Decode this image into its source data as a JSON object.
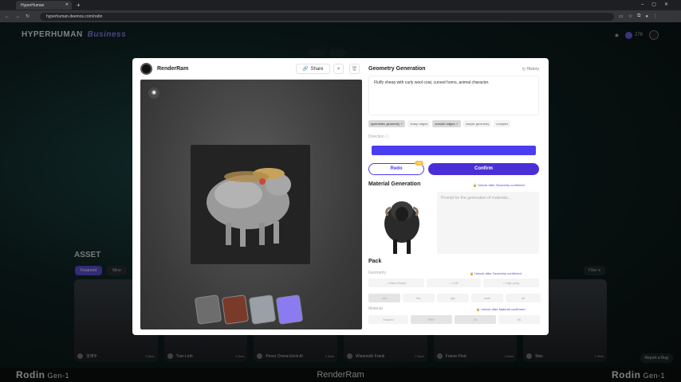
{
  "browser": {
    "tab_title": "HyperHuman",
    "url": "hyperhuman.deemos.com/rodin"
  },
  "header": {
    "brand": "HYPERHUMAN",
    "brand_suffix": "Business",
    "credits": "276"
  },
  "background": {
    "section_title": "ASSET",
    "filters": [
      "Featured",
      "Mine"
    ],
    "filter_button": "Filter",
    "cards": [
      {
        "author": "임재두",
        "likes": "2 likes"
      },
      {
        "author": "Tran Linh",
        "likes": "2 likes"
      },
      {
        "author": "Perez Orona Erick Al",
        "likes": "2 likes"
      },
      {
        "author": "Wiesmath Frank",
        "likes": "2 likes"
      },
      {
        "author": "Future Pied",
        "likes": "2 likes"
      },
      {
        "author": "Max",
        "likes": "2 likes"
      }
    ],
    "report_bug": "Report a Bug",
    "footer_left": "Rodin",
    "footer_left_suffix": "Gen-1",
    "footer_mid": "RenderRam",
    "footer_right": "Rodin",
    "footer_right_suffix": "Gen-1"
  },
  "modal": {
    "owner_name": "RenderRam",
    "share_label": "Share",
    "geometry": {
      "title": "Geometry Generation",
      "history_label": "History",
      "prompt": "Fluffy sheep with curly wool coat, curved horns, animal character.",
      "chips": [
        {
          "label": "symmetric geometry ✓",
          "selected": true
        },
        {
          "label": "sharp edges",
          "selected": false
        },
        {
          "label": "smooth edges ✓",
          "selected": true
        },
        {
          "label": "simple geometry",
          "selected": false
        },
        {
          "label": "complex",
          "selected": false
        }
      ],
      "direction_label": "Direction ⓘ",
      "redo_label": "Redo",
      "redo_tag": "+50",
      "confirm_label": "Confirm"
    },
    "material": {
      "title": "Material Generation",
      "lock_text": "Unlock after Geometry confirmed",
      "prompt_placeholder": "Prompt for the generation of materials..."
    },
    "pack": {
      "title": "Pack",
      "geometry_label": "Geometry",
      "geometry_lock": "Unlock after Geometry confirmed",
      "geometry_options": [
        "Base Model",
        "LOD",
        "High-poly"
      ],
      "format_options": [
        "obj",
        "fbx",
        "glb",
        "usdz",
        "stl"
      ],
      "material_label": "Material",
      "material_lock": "Unlock after Material confirmed",
      "material_options": [
        "Shaded",
        "PBR",
        "1K",
        "4K"
      ]
    }
  },
  "colors": {
    "accent": "#4b2fd6",
    "direction_bar": "#4b3cf0",
    "brand_suffix": "#8e7cf0"
  }
}
